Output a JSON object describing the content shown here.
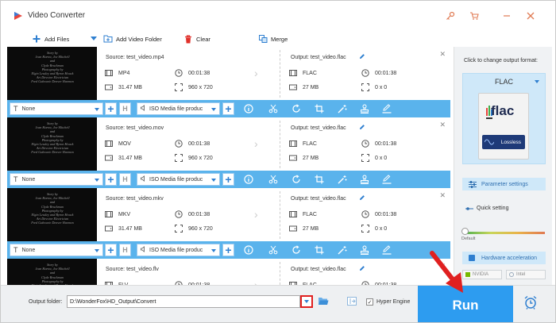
{
  "window": {
    "title": "Video Converter"
  },
  "toolbar": {
    "add_files": "Add Files",
    "add_video_folder": "Add Video Folder",
    "clear": "Clear",
    "merge": "Merge"
  },
  "files": [
    {
      "source_label": "Source: test_video.mp4",
      "src_format": "MP4",
      "src_duration": "00:01:38",
      "src_size": "31.47 MB",
      "src_resolution": "960 x 720",
      "output_label": "Output: test_video.flac",
      "out_format": "FLAC",
      "out_duration": "00:01:38",
      "out_size": "27 MB",
      "out_resolution": "0 x 0",
      "subtitle": "None",
      "audio": "ISO Media file produc"
    },
    {
      "source_label": "Source: test_video.mov",
      "src_format": "MOV",
      "src_duration": "00:01:38",
      "src_size": "31.47 MB",
      "src_resolution": "960 x 720",
      "output_label": "Output: test_video.flac",
      "out_format": "FLAC",
      "out_duration": "00:01:38",
      "out_size": "27 MB",
      "out_resolution": "0 x 0",
      "subtitle": "None",
      "audio": "ISO Media file produc"
    },
    {
      "source_label": "Source: test_video.mkv",
      "src_format": "MKV",
      "src_duration": "00:01:38",
      "src_size": "31.47 MB",
      "src_resolution": "960 x 720",
      "output_label": "Output: test_video.flac",
      "out_format": "FLAC",
      "out_duration": "00:01:38",
      "out_size": "27 MB",
      "out_resolution": "0 x 0",
      "subtitle": "None",
      "audio": "ISO Media file produc"
    },
    {
      "source_label": "Source: test_video.flv",
      "src_format": "FLV",
      "src_duration": "00:01:38",
      "output_label": "Output: test_video.flac",
      "out_format": "FLAC",
      "out_duration": "00:01:38"
    }
  ],
  "thumbnail_credits": "Story by\nJean Harow, Joe Mitchell\nand\nClyde Bruckman\nPhotography by\nElgin Lessley and Byron Houck\nArt Director  Electrician\nFred Gabourie  Denver Harmon",
  "right_panel": {
    "title": "Click to change output format:",
    "format": "FLAC",
    "format_logo_text": "flac",
    "format_logo_sub": "Lossless",
    "parameter_settings": "Parameter settings",
    "quick_setting": "Quick setting",
    "slider_default": "Default",
    "hardware_acceleration": "Hardware acceleration",
    "nvidia": "NVIDIA",
    "intel": "Intel"
  },
  "bottom": {
    "output_folder_label": "Output folder:",
    "output_path": "D:\\WonderFox\\HD_Output\\Convert",
    "hyper_engine": "Hyper Engine",
    "hyper_engine_checked": true,
    "run": "Run"
  },
  "colors": {
    "accent": "#5ab3ec",
    "run": "#2d9cf0",
    "highlight_red": "#e02020"
  }
}
